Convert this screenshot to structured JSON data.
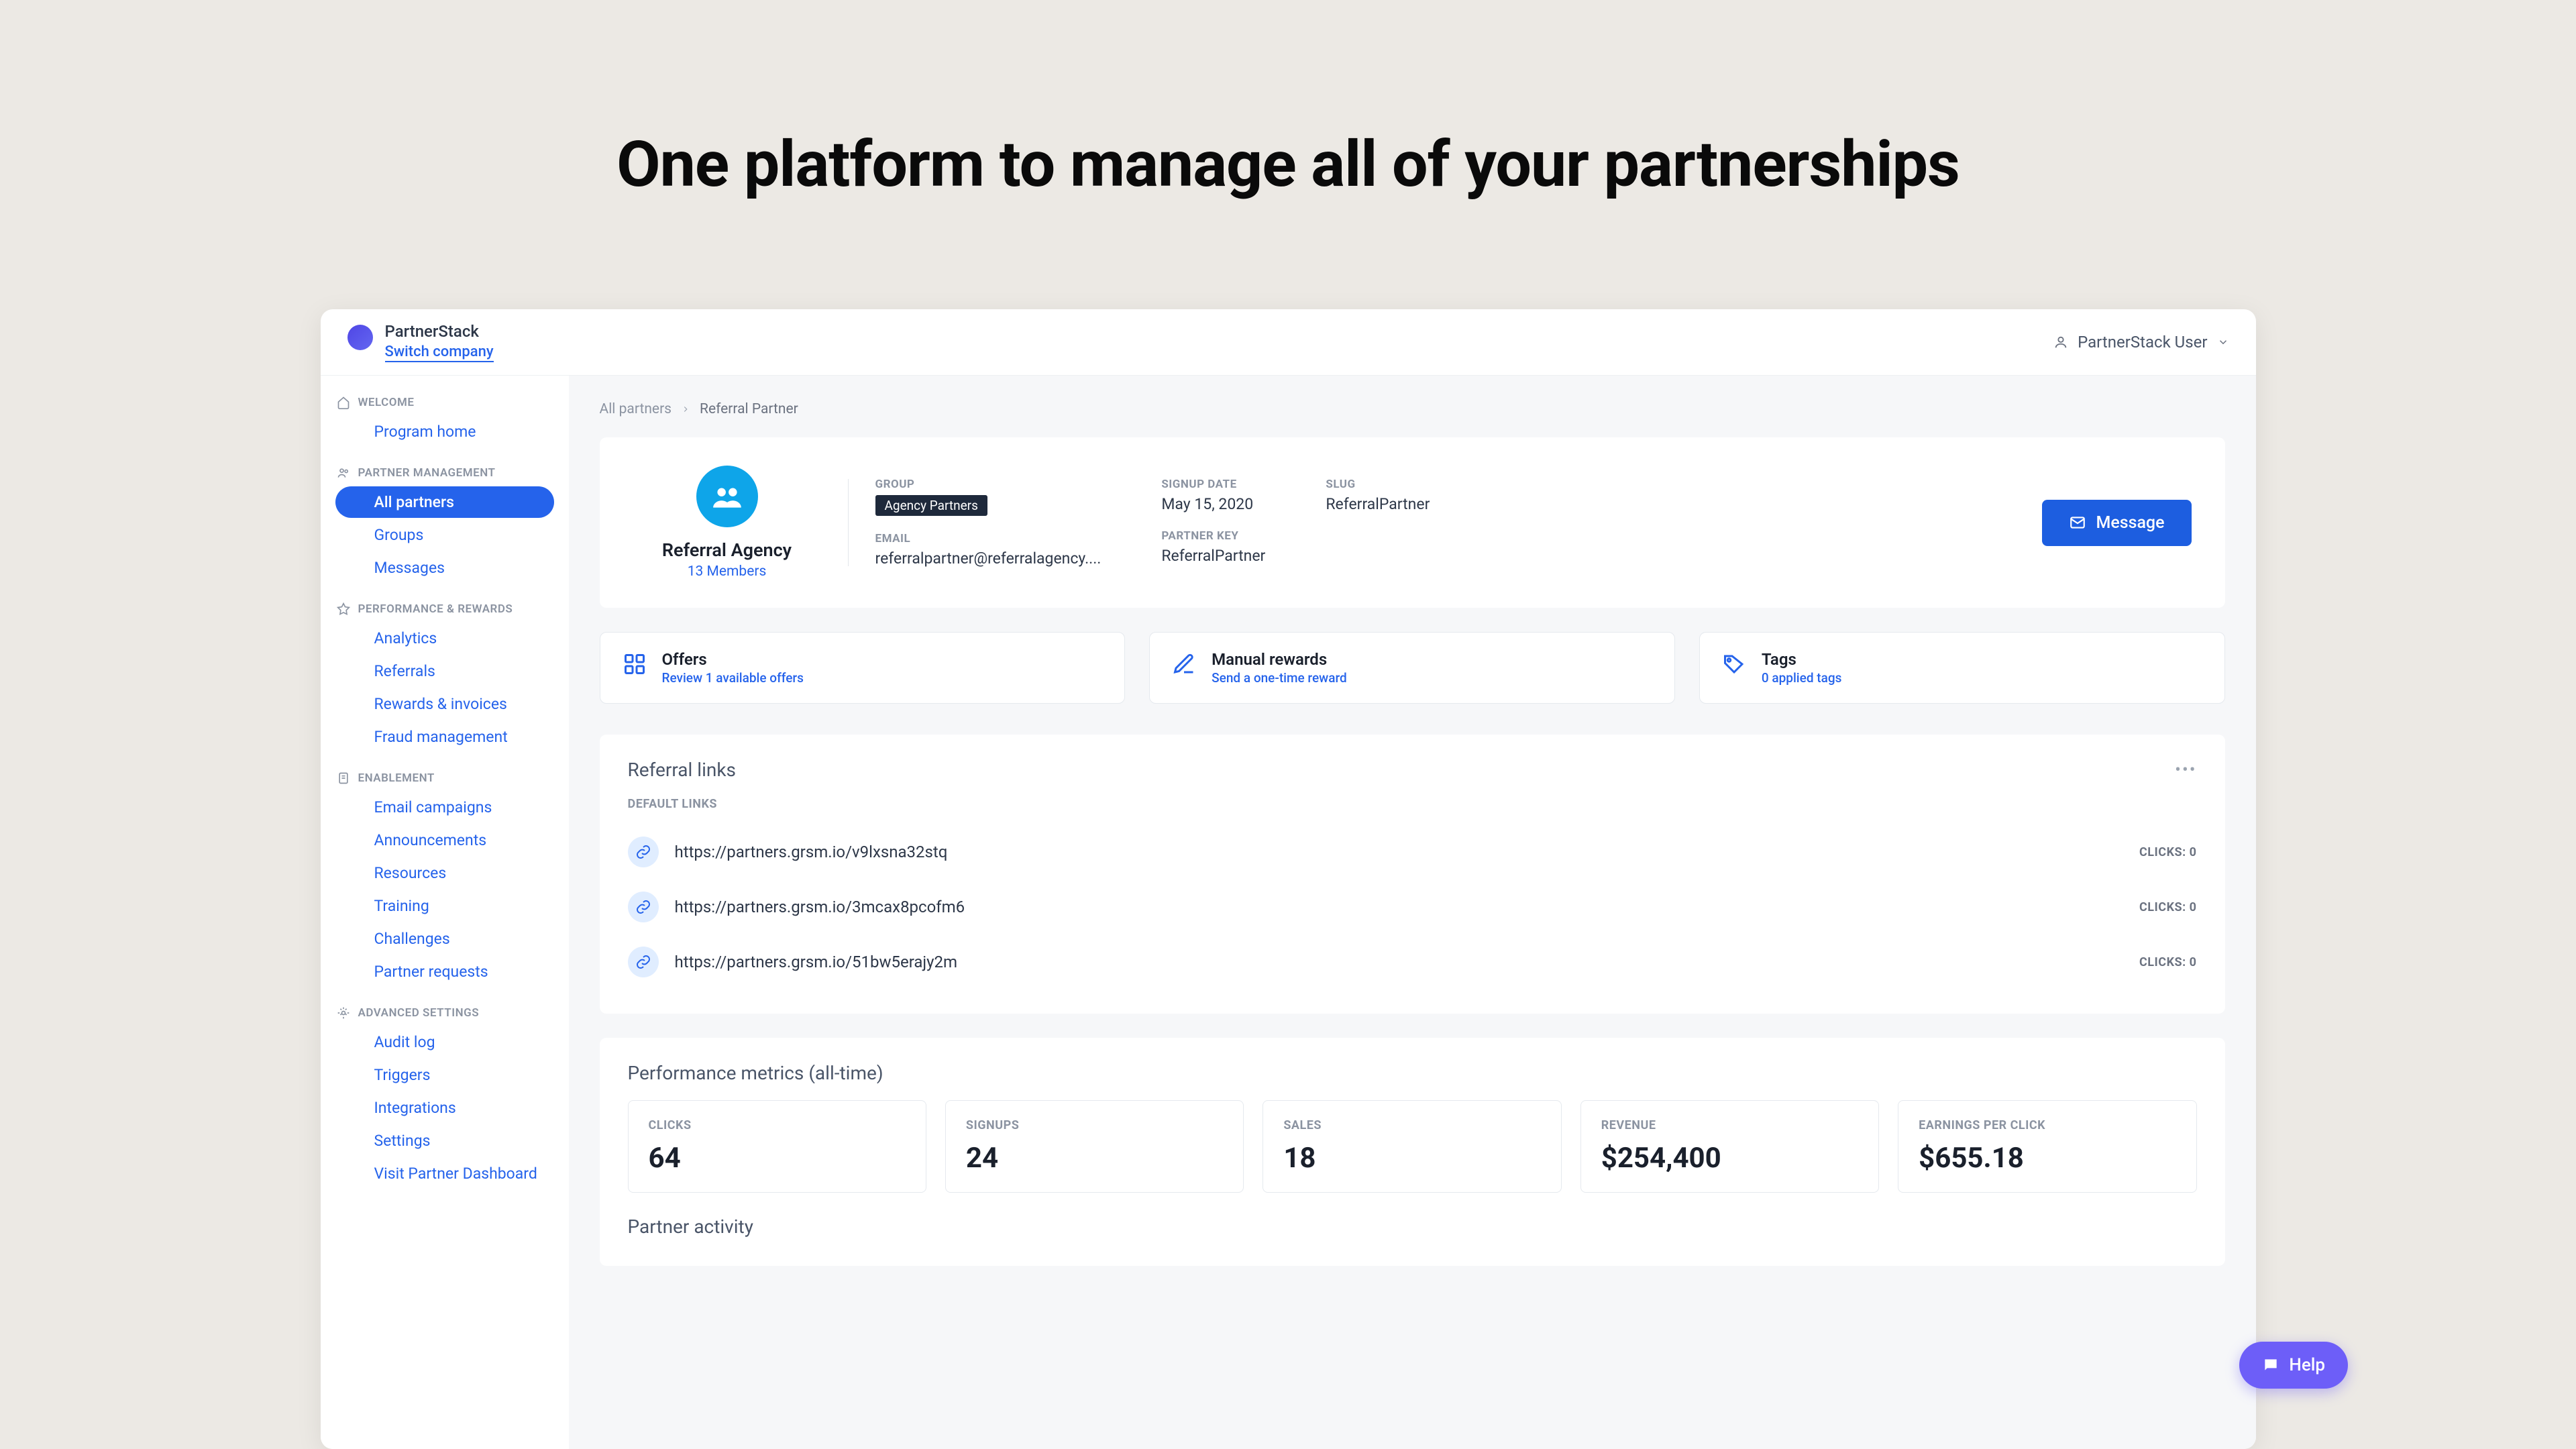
{
  "headline": "One platform to manage all of your partnerships",
  "topbar": {
    "company": "PartnerStack",
    "switch": "Switch company",
    "user": "PartnerStack User"
  },
  "sidebar": {
    "welcome": {
      "header": "WELCOME",
      "items": [
        "Program home"
      ]
    },
    "partner": {
      "header": "PARTNER MANAGEMENT",
      "items": [
        "All partners",
        "Groups",
        "Messages"
      ]
    },
    "performance": {
      "header": "PERFORMANCE & REWARDS",
      "items": [
        "Analytics",
        "Referrals",
        "Rewards & invoices",
        "Fraud management"
      ]
    },
    "enablement": {
      "header": "ENABLEMENT",
      "items": [
        "Email campaigns",
        "Announcements",
        "Resources",
        "Training",
        "Challenges",
        "Partner requests"
      ]
    },
    "advanced": {
      "header": "ADVANCED SETTINGS",
      "items": [
        "Audit log",
        "Triggers",
        "Integrations",
        "Settings",
        "Visit Partner Dashboard"
      ]
    }
  },
  "breadcrumb": {
    "root": "All partners",
    "current": "Referral Partner"
  },
  "profile": {
    "name": "Referral Agency",
    "members": "13 Members",
    "group_lbl": "GROUP",
    "group_val": "Agency Partners",
    "email_lbl": "EMAIL",
    "email_val": "referralpartner@referralagency....",
    "signup_lbl": "SIGNUP DATE",
    "signup_val": "May 15, 2020",
    "key_lbl": "PARTNER KEY",
    "key_val": "ReferralPartner",
    "slug_lbl": "SLUG",
    "slug_val": "ReferralPartner",
    "msg_btn": "Message"
  },
  "quick": {
    "offers": {
      "title": "Offers",
      "sub": "Review 1 available offers"
    },
    "rewards": {
      "title": "Manual rewards",
      "sub": "Send a one-time reward"
    },
    "tags": {
      "title": "Tags",
      "sub": "0 applied tags"
    }
  },
  "links": {
    "title": "Referral links",
    "default_lbl": "DEFAULT LINKS",
    "rows": [
      {
        "url": "https://partners.grsm.io/v9lxsna32stq",
        "clicks": "CLICKS: 0"
      },
      {
        "url": "https://partners.grsm.io/3mcax8pcofm6",
        "clicks": "CLICKS: 0"
      },
      {
        "url": "https://partners.grsm.io/51bw5erajy2m",
        "clicks": "CLICKS: 0"
      }
    ]
  },
  "metrics": {
    "title": "Performance metrics (all-time)",
    "cards": [
      {
        "lbl": "CLICKS",
        "val": "64"
      },
      {
        "lbl": "SIGNUPS",
        "val": "24"
      },
      {
        "lbl": "SALES",
        "val": "18"
      },
      {
        "lbl": "REVENUE",
        "val": "$254,400"
      },
      {
        "lbl": "EARNINGS PER CLICK",
        "val": "$655.18"
      }
    ]
  },
  "activity_title": "Partner activity",
  "help": "Help"
}
